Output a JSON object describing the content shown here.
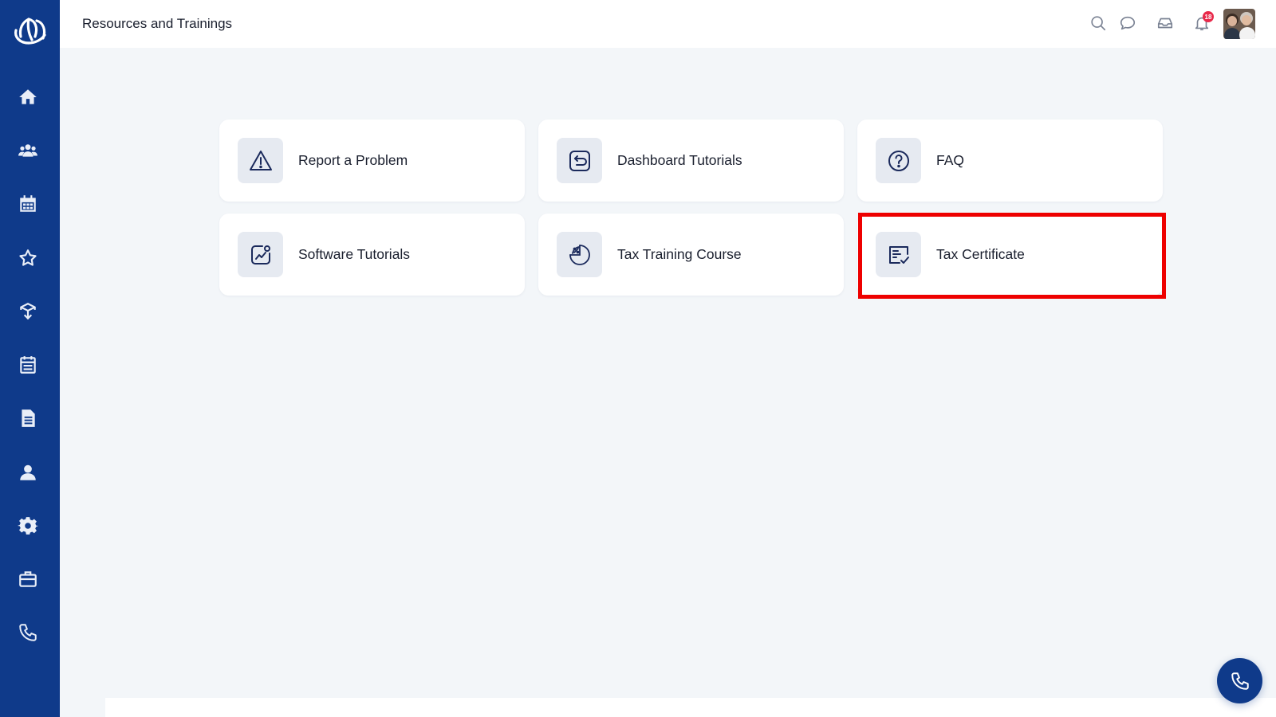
{
  "header": {
    "title": "Resources and Trainings",
    "notification_count": "18"
  },
  "sidebar": {
    "logo": "lotus-logo",
    "items": [
      {
        "icon": "home-icon"
      },
      {
        "icon": "users-icon"
      },
      {
        "icon": "calendar-icon"
      },
      {
        "icon": "star-icon"
      },
      {
        "icon": "box-icon"
      },
      {
        "icon": "schedule-icon"
      },
      {
        "icon": "document-icon"
      },
      {
        "icon": "profile-icon"
      },
      {
        "icon": "gear-icon"
      },
      {
        "icon": "briefcase-icon"
      },
      {
        "icon": "phone-icon"
      }
    ]
  },
  "topbar_icons": [
    "search-icon",
    "chat-icon",
    "inbox-icon",
    "bell-icon"
  ],
  "cards": [
    {
      "label": "Report a Problem",
      "icon": "warning-icon"
    },
    {
      "label": "Dashboard Tutorials",
      "icon": "return-icon"
    },
    {
      "label": "FAQ",
      "icon": "question-icon"
    },
    {
      "label": "Software Tutorials",
      "icon": "chart-icon"
    },
    {
      "label": "Tax Training Course",
      "icon": "percent-icon"
    },
    {
      "label": "Tax Certificate",
      "icon": "certificate-icon"
    }
  ],
  "colors": {
    "sidebar": "#0f3a8a",
    "background": "#f3f6f9",
    "accent_icon": "#1b2a5c",
    "highlight": "#ee0000",
    "badge": "#e8294a"
  }
}
